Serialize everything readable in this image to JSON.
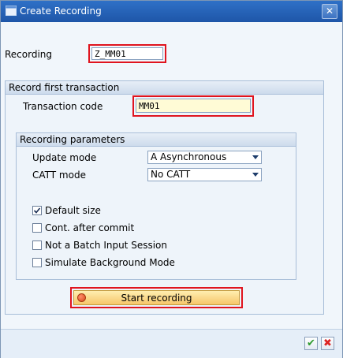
{
  "window": {
    "title": "Create Recording",
    "close_symbol": "✕"
  },
  "recording": {
    "label": "Recording",
    "value": "Z_MM01"
  },
  "first_transaction": {
    "heading": "Record first transaction",
    "tcode_label": "Transaction code",
    "tcode_value": "MM01"
  },
  "parameters": {
    "heading": "Recording parameters",
    "update_mode_label": "Update mode",
    "update_mode_value": "A Asynchronous",
    "catt_mode_label": "CATT mode",
    "catt_mode_value": "No CATT",
    "checkboxes": [
      {
        "label": "Default size",
        "checked": true
      },
      {
        "label": "Cont. after commit",
        "checked": false
      },
      {
        "label": "Not a Batch Input Session",
        "checked": false
      },
      {
        "label": "Simulate Background Mode",
        "checked": false
      }
    ]
  },
  "start_button": {
    "label": "Start recording"
  },
  "footer": {
    "ok_symbol": "✔",
    "cancel_symbol": "✖"
  },
  "colors": {
    "titlebar": "#1e56a8",
    "highlight": "#e0141e",
    "ok": "#2e9a2e",
    "cancel": "#d22"
  }
}
